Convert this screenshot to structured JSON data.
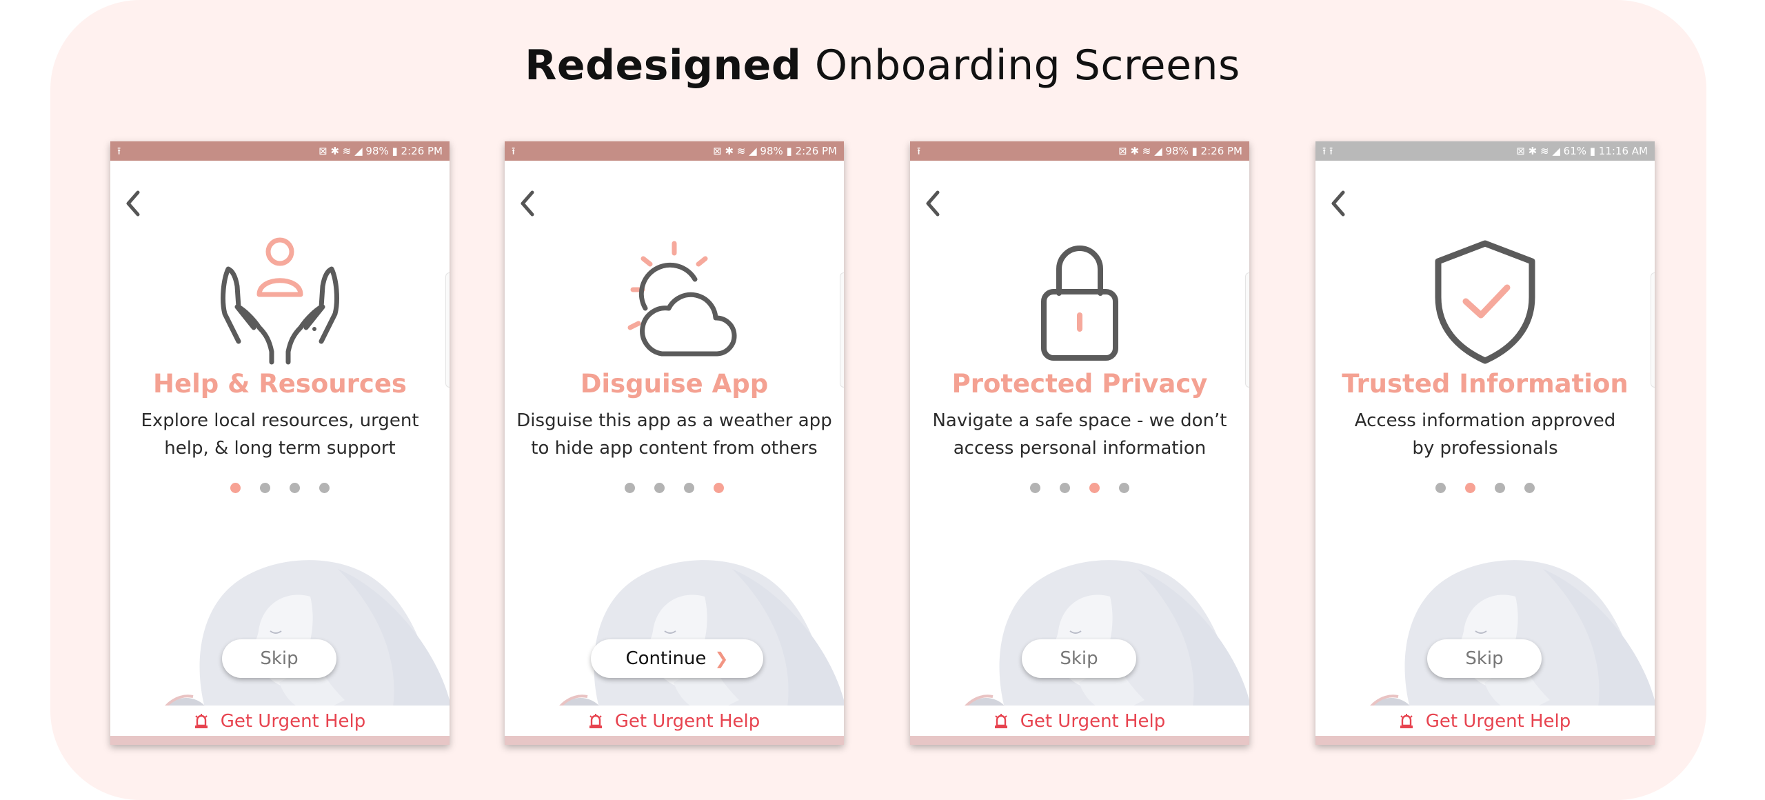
{
  "heading": {
    "bold": "Redesigned",
    "light": "Onboarding Screens"
  },
  "colors": {
    "accent": "#f4a192",
    "urgent": "#e7434f",
    "statusbar": "#c58e86",
    "statusbar_alt": "#b9b9b9"
  },
  "screens": [
    {
      "status": {
        "left": "⭱",
        "right": "⊠ ✱ ≋ ◢ 98% ▮ 2:26 PM"
      },
      "icon": "hands-holding-person-icon",
      "title": "Help & Resources",
      "desc_line1": "Explore local resources, urgent",
      "desc_line2": "help, & long term support",
      "active_dot": 0,
      "button": "Skip",
      "urgent": "Get Urgent Help"
    },
    {
      "status": {
        "left": "⭱",
        "right": "⊠ ✱ ≋ ◢ 98% ▮ 2:26 PM"
      },
      "icon": "sun-cloud-icon",
      "title": "Disguise App",
      "desc_line1": "Disguise this app as a weather app",
      "desc_line2": "to hide app content from others",
      "active_dot": 3,
      "button": "Continue",
      "urgent": "Get Urgent Help"
    },
    {
      "status": {
        "left": "⭱",
        "right": "⊠ ✱ ≋ ◢ 98% ▮ 2:26 PM"
      },
      "icon": "padlock-icon",
      "title": "Protected Privacy",
      "desc_line1": "Navigate a safe space - we don’t",
      "desc_line2": "access personal information",
      "active_dot": 2,
      "button": "Skip",
      "urgent": "Get Urgent Help"
    },
    {
      "status": {
        "left": "⭱ ⭱",
        "right": "⊠ ✱ ≋ ◢ 61% ▮ 11:16 AM"
      },
      "icon": "shield-check-icon",
      "title": "Trusted Information",
      "desc_line1": "Access information approved",
      "desc_line2": "by professionals",
      "active_dot": 1,
      "button": "Skip",
      "urgent": "Get Urgent Help"
    }
  ]
}
